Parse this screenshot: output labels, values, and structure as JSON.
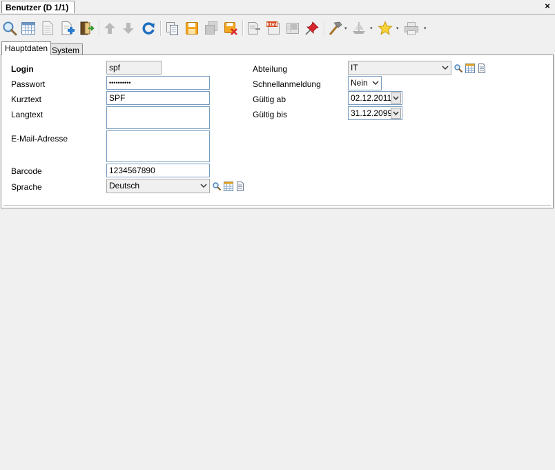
{
  "window": {
    "tab_title": "Benutzer (D 1/1)",
    "close_glyph": "×"
  },
  "toolbar": {
    "buttons": [
      "search-icon",
      "table-icon",
      "document-icon",
      "new-document-icon",
      "exit-icon",
      "arrow-up-icon",
      "arrow-down-icon",
      "refresh-icon",
      "copy-icon",
      "save-icon",
      "save-all-icon",
      "save-delete-icon",
      "export-icon",
      "html-icon",
      "excel-icon",
      "pin-icon",
      "hammer-icon",
      "ship-icon",
      "star-icon",
      "printer-icon"
    ]
  },
  "tabs": {
    "main": "Hauptdaten",
    "system": "System"
  },
  "form": {
    "login_label": "Login",
    "login_value": "spf",
    "passwort_label": "Passwort",
    "passwort_value": "••••••••••",
    "kurztext_label": "Kurztext",
    "kurztext_value": "SPF",
    "langtext_label": "Langtext",
    "langtext_value": "",
    "email_label": "E-Mail-Adresse",
    "email_value": "",
    "barcode_label": "Barcode",
    "barcode_value": "1234567890",
    "sprache_label": "Sprache",
    "sprache_value": "Deutsch",
    "abteilung_label": "Abteilung",
    "abteilung_value": "IT",
    "schnell_label": "Schnellanmeldung",
    "schnell_value": "Nein",
    "gueltig_ab_label": "Gültig ab",
    "gueltig_ab_value": "02.12.2011",
    "gueltig_bis_label": "Gültig bis",
    "gueltig_bis_value": "31.12.2099"
  },
  "colors": {
    "field_border": "#7a9cbf",
    "panel_bg": "#ffffff",
    "app_bg": "#f0f0f0"
  }
}
